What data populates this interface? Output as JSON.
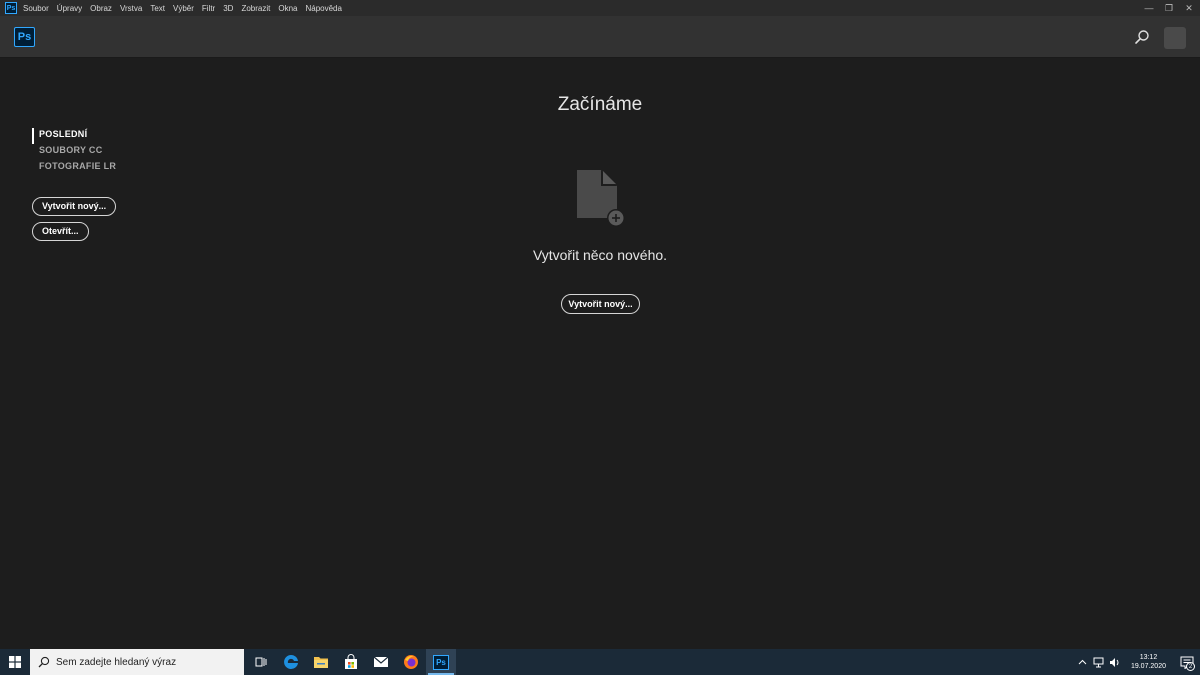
{
  "app": {
    "icon_text": "Ps",
    "accent_color": "#31a8ff"
  },
  "menu": {
    "items": [
      "Soubor",
      "Úpravy",
      "Obraz",
      "Vrstva",
      "Text",
      "Výběr",
      "Filtr",
      "3D",
      "Zobrazit",
      "Okna",
      "Nápověda"
    ]
  },
  "window_controls": {
    "minimize": "—",
    "restore": "❐",
    "close": "✕"
  },
  "header": {
    "logo_text": "Ps",
    "search_icon": "search-icon",
    "avatar_icon": "avatar"
  },
  "sidebar": {
    "tabs": [
      {
        "label": "POSLEDNÍ",
        "active": true
      },
      {
        "label": "SOUBORY CC",
        "active": false
      },
      {
        "label": "FOTOGRAFIE LR",
        "active": false
      }
    ],
    "create_label": "Vytvořit nový...",
    "open_label": "Otevřít..."
  },
  "main": {
    "title": "Začínáme",
    "subtitle": "Vytvořit něco nového.",
    "create_label": "Vytvořit nový...",
    "icon": "new-document-icon"
  },
  "taskbar": {
    "search_placeholder": "Sem zadejte hledaný výraz",
    "apps": [
      "task-view-icon",
      "edge-icon",
      "file-explorer-icon",
      "store-icon",
      "mail-icon",
      "firefox-icon",
      "photoshop-icon"
    ],
    "active_app_label": "Ps",
    "clock_time": "13:12",
    "clock_date": "19.07.2020",
    "notifications_count": "2"
  }
}
